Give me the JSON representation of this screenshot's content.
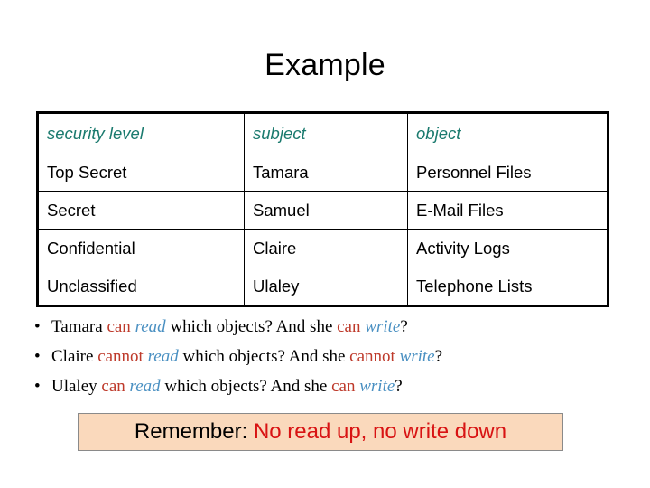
{
  "slide": {
    "title": "Example"
  },
  "table": {
    "headers": [
      "security level",
      "subject",
      "object"
    ],
    "header_color": "#1a7a6e",
    "rows": [
      [
        "Top Secret",
        "Tamara",
        "Personnel Files"
      ],
      [
        "Secret",
        "Samuel",
        "E-Mail Files"
      ],
      [
        "Confidential",
        "Claire",
        "Activity Logs"
      ],
      [
        "Unclassified",
        "Ulaley",
        "Telephone Lists"
      ]
    ]
  },
  "bullets": {
    "marker": "•",
    "items": [
      {
        "seg1": "Tamara ",
        "permission1": "can",
        "space1": " ",
        "action1": "read",
        "seg2": " which objects? And she ",
        "permission2": "can",
        "space2": " ",
        "action2": "write",
        "seg3": "?"
      },
      {
        "seg1": "Claire ",
        "permission1": "cannot",
        "space1": " ",
        "action1": "read",
        "seg2": " which objects? And she ",
        "permission2": "cannot",
        "space2": " ",
        "action2": "write",
        "seg3": "?"
      },
      {
        "seg1": "Ulaley ",
        "permission1": "can",
        "space1": " ",
        "action1": "read",
        "seg2": " which objects? And she ",
        "permission2": "can",
        "space2": " ",
        "action2": "write",
        "seg3": "?"
      }
    ],
    "permission_color": "#be3a2b",
    "action_color": "#4a90c2"
  },
  "callout": {
    "prefix": "Remember: ",
    "accent": "No read up, no write down",
    "background_color": "#fad9bc",
    "border_color": "#8a8a8a",
    "accent_color": "#d81313"
  }
}
